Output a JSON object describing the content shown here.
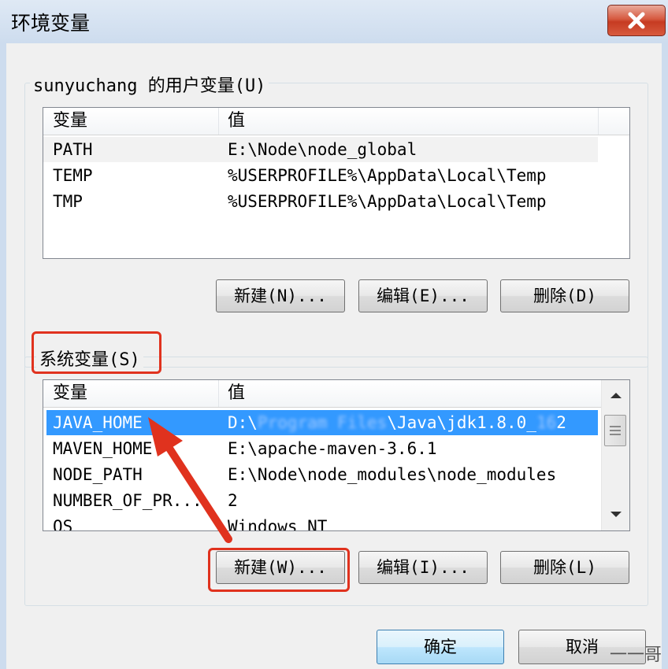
{
  "window": {
    "title": "环境变量"
  },
  "user_vars": {
    "group_label": "sunyuchang 的用户变量(U)",
    "columns": [
      "变量",
      "值"
    ],
    "rows": [
      {
        "name": "PATH",
        "value": "E:\\Node\\node_global"
      },
      {
        "name": "TEMP",
        "value": "%USERPROFILE%\\AppData\\Local\\Temp"
      },
      {
        "name": "TMP",
        "value": "%USERPROFILE%\\AppData\\Local\\Temp"
      }
    ],
    "buttons": {
      "new": "新建(N)...",
      "edit": "编辑(E)...",
      "delete": "删除(D)"
    }
  },
  "system_vars": {
    "group_label": "系统变量(S)",
    "columns": [
      "变量",
      "值"
    ],
    "rows": [
      {
        "name": "JAVA_HOME",
        "value_prefix": "D:\\",
        "value_suffix": "\\Java\\jdk1.8.0_",
        "value_end": "2",
        "selected": true
      },
      {
        "name": "MAVEN_HOME",
        "value": "E:\\apache-maven-3.6.1"
      },
      {
        "name": "NODE_PATH",
        "value": "E:\\Node\\node_modules\\node_modules"
      },
      {
        "name": "NUMBER_OF_PR...",
        "value": "2"
      },
      {
        "name": "OS",
        "value": "Windows_NT"
      }
    ],
    "buttons": {
      "new": "新建(W)...",
      "edit": "编辑(I)...",
      "delete": "删除(L)"
    }
  },
  "footer": {
    "ok": "确定",
    "cancel": "取消"
  },
  "watermark": "一一哥",
  "colors": {
    "selection": "#3399ff",
    "annotation": "#e0321e",
    "title_bar": "#cddcee"
  },
  "icons": {
    "close": "close-icon",
    "scroll_up": "scroll-up-arrow-icon",
    "scroll_down": "scroll-down-arrow-icon"
  }
}
